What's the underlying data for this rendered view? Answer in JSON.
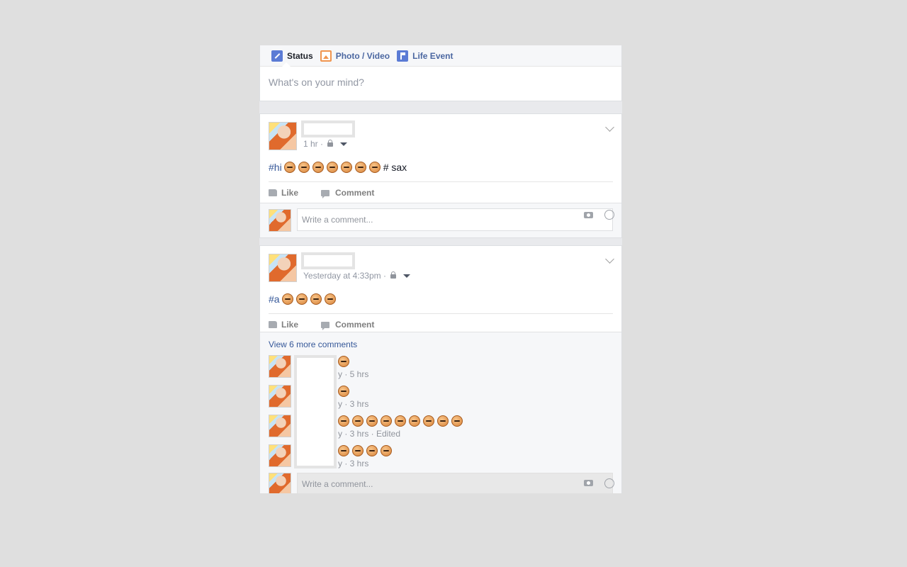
{
  "composer": {
    "tabs": [
      {
        "label": "Status",
        "icon": "pencil-icon",
        "active": true
      },
      {
        "label": "Photo / Video",
        "icon": "photo-icon",
        "active": false
      },
      {
        "label": "Life Event",
        "icon": "flag-icon",
        "active": false
      }
    ],
    "placeholder": "What's on your mind?"
  },
  "posts": [
    {
      "time": "1 hr ·",
      "hashtag": "#hi",
      "tail": "# sax",
      "emoji_count": 7,
      "like_label": "Like",
      "comment_label": "Comment",
      "write_placeholder": "Write a comment..."
    },
    {
      "time": "Yesterday at 4:33pm ·",
      "hashtag": "#a",
      "emoji_count": 4,
      "like_label": "Like",
      "comment_label": "Comment",
      "view_more": "View 6 more comments",
      "comments": [
        {
          "emoji_count": 1,
          "meta": "y · 5 hrs"
        },
        {
          "emoji_count": 1,
          "meta": "y · 3 hrs"
        },
        {
          "emoji_count": 9,
          "meta": "y · 3 hrs · Edited"
        },
        {
          "emoji_count": 4,
          "meta": "y · 3 hrs"
        }
      ],
      "write_placeholder": "Write a comment..."
    }
  ],
  "colors": {
    "link": "#365899",
    "muted": "#9197a3",
    "background": "#dfdfdf"
  }
}
